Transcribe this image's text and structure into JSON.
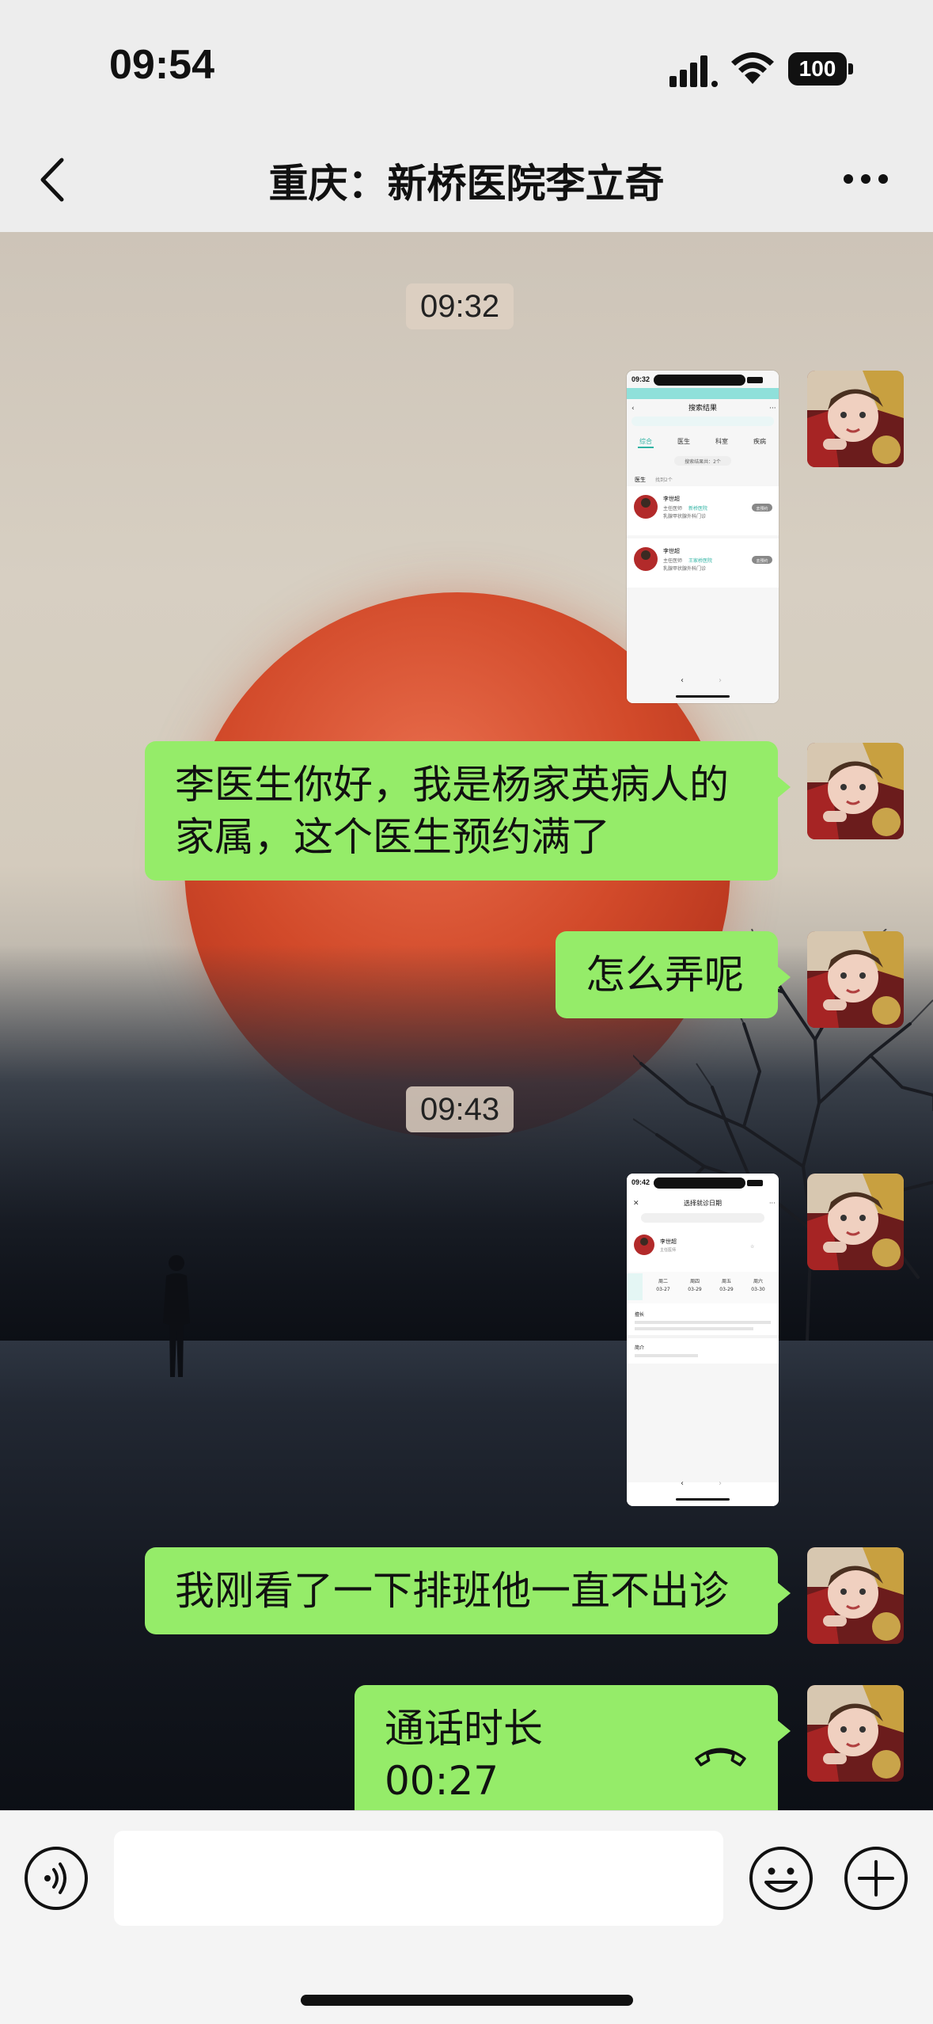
{
  "status_bar": {
    "time": "09:54",
    "battery": "100"
  },
  "nav": {
    "title": "重庆：新桥医院李立奇"
  },
  "messages": {
    "ts1": "09:32",
    "msg1_line1": "李医生你好，我是杨家英病人的",
    "msg1_line2": "家属，这个医生预约满了",
    "msg2": "怎么弄呢",
    "ts2": "09:43",
    "msg3": "我刚看了一下排班他一直不出诊",
    "call_label": "通话时长 00:27"
  },
  "thumb1": {
    "time": "09:32",
    "header": "搜索结果",
    "tabs": [
      "综合",
      "医生",
      "科室",
      "疾病"
    ],
    "filter": "搜索结果共：2个",
    "section": "医生",
    "section_count": "找到2个",
    "doctors": [
      {
        "name": "李世超",
        "title": "主任医师",
        "hospital": "新桥医院",
        "dept": "乳腺甲状腺外科门诊"
      },
      {
        "name": "李世超",
        "title": "主任医师",
        "hospital": "王家桥医院",
        "dept": "乳腺甲状腺外科门诊"
      }
    ],
    "book": "去预约"
  },
  "thumb2": {
    "time": "09:42",
    "header": "选择就诊日期",
    "doctor": "李世超",
    "doctor_title": "主任医师",
    "dates": [
      "周二",
      "周四",
      "周五",
      "周六"
    ],
    "date_nums": [
      "03-27",
      "03-29",
      "03-29",
      "03-30"
    ],
    "intro_head": "擅长",
    "bio_head": "简介"
  },
  "colors": {
    "bubble": "#95ec69",
    "accent": "#2fb3a3"
  }
}
